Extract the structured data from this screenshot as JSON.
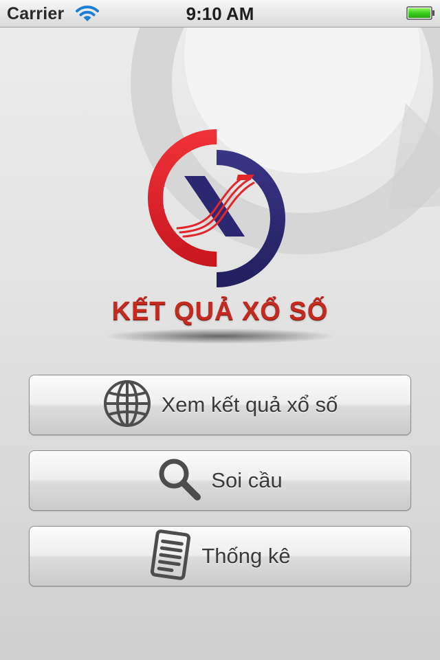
{
  "status_bar": {
    "carrier": "Carrier",
    "time": "9:10 AM"
  },
  "logo": {
    "text": "KẾT QUẢ XỔ SỐ",
    "letter": "X",
    "colors": {
      "red": "#e3262a",
      "navy": "#2b2770"
    }
  },
  "menu": {
    "items": [
      {
        "label": "Xem kết quả xổ số",
        "icon": "globe-icon"
      },
      {
        "label": "Soi cầu",
        "icon": "search-icon"
      },
      {
        "label": "Thống kê",
        "icon": "document-icon"
      }
    ]
  }
}
